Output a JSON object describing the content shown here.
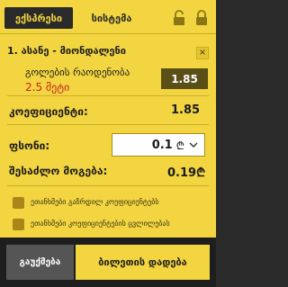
{
  "header": {
    "tab_express": "ექსპრესი",
    "tab_system": "სისტემა",
    "icons": [
      "lock-open-icon",
      "lock-closed-icon"
    ]
  },
  "bet": {
    "title": "1. ასანე - მიონდალენი",
    "market": "გოლების რაოდენობა",
    "selection": "2.5 მეტი",
    "odds": "1.85",
    "remove_symbol": "×"
  },
  "summary": {
    "coef_label": "კოეფიციენტი:",
    "coef_value": "1.85",
    "stake_label": "ფსონი:",
    "stake_value": "0.1",
    "currency": "₾",
    "win_label": "შესაძლო მოგება:",
    "win_value": "0.19₾"
  },
  "options": [
    "ეთანხმები გაზრდილ კოეფიციენტებს",
    "ეთანხმები კოეფიციენტების ცვლილებას"
  ],
  "footer": {
    "clear_label": "გაუქმება",
    "place_label": "ბილეთის დადება"
  },
  "colors": {
    "accent": "#f2d541",
    "dark": "#2a2a2a",
    "odds_bg": "#5a4f16",
    "selection_red": "#c62222"
  }
}
